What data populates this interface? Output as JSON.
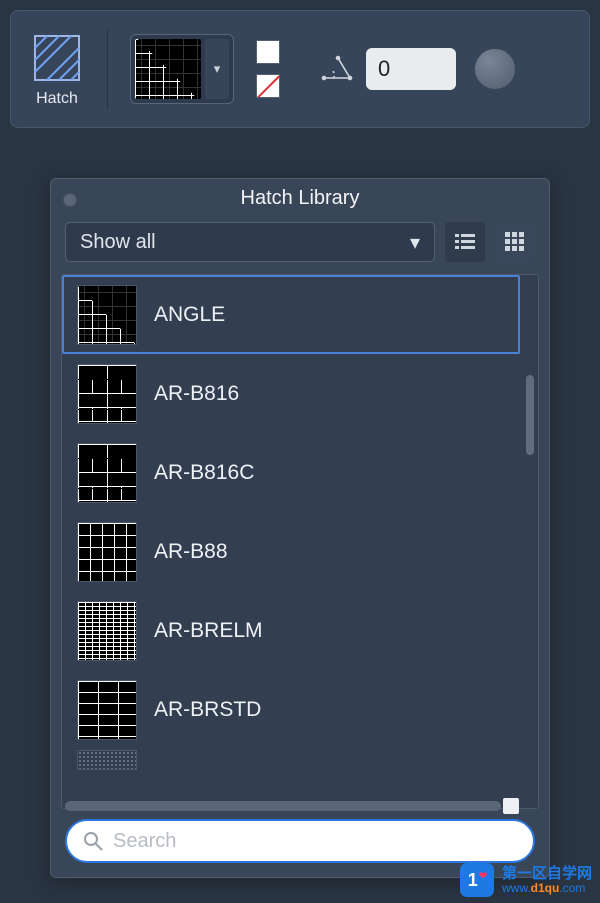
{
  "toolbar": {
    "tool_label": "Hatch",
    "angle_value": "0"
  },
  "panel": {
    "title": "Hatch Library",
    "filter_label": "Show all",
    "search_placeholder": "Search",
    "items": [
      {
        "label": "ANGLE",
        "pattern": "p-angle",
        "selected": true
      },
      {
        "label": "AR-B816",
        "pattern": "p-b816",
        "selected": false
      },
      {
        "label": "AR-B816C",
        "pattern": "p-b816",
        "selected": false
      },
      {
        "label": "AR-B88",
        "pattern": "p-b88",
        "selected": false
      },
      {
        "label": "AR-BRELM",
        "pattern": "p-brelm",
        "selected": false
      },
      {
        "label": "AR-BRSTD",
        "pattern": "p-brstd",
        "selected": false
      }
    ]
  },
  "watermark": {
    "badge": "1",
    "title": "第一区自学网",
    "url_pre": "www.",
    "url_mid": "d1qu",
    "url_suf": ".com"
  }
}
